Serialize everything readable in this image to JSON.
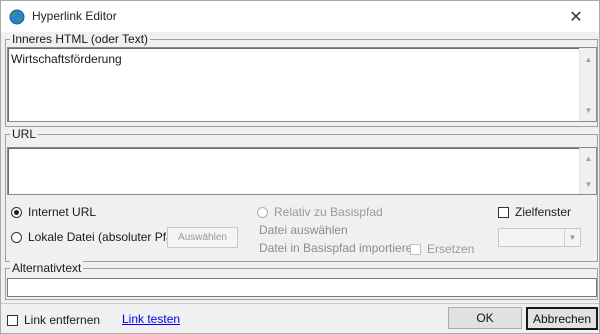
{
  "window": {
    "title": "Hyperlink Editor"
  },
  "inner_html": {
    "legend": "Inneres HTML (oder Text)",
    "value": "Wirtschaftsförderung"
  },
  "url": {
    "legend": "URL",
    "value": "",
    "radio_internet": "Internet URL",
    "radio_local": "Lokale Datei (absoluter Pfad",
    "browse_label": "Auswählen",
    "radio_relative": "Relativ zu Basispfad",
    "select_file_label": "Datei auswählen",
    "import_label": "Datei in Basispfad importieren",
    "replace_label": "Ersetzen",
    "target_window_label": "Zielfenster",
    "target_value": ""
  },
  "alt_text": {
    "legend": "Alternativtext",
    "value": ""
  },
  "footer": {
    "remove_link_label": "Link entfernen",
    "test_link_label": "Link testen",
    "ok_label": "OK",
    "cancel_label": "Abbrechen"
  },
  "icons": {
    "app": "globe-icon",
    "close": "close-icon"
  }
}
